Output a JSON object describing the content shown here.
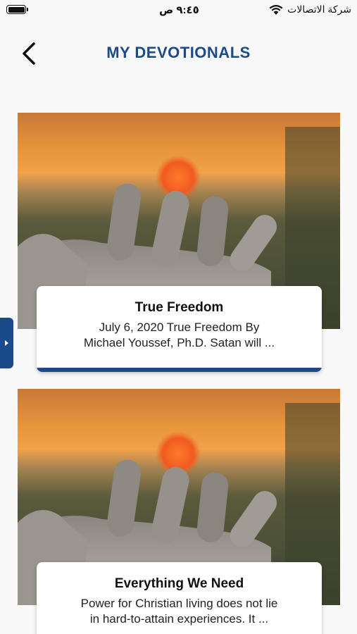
{
  "status_bar": {
    "time": "٩:٤٥ ص",
    "carrier": "شركة الاتصالات"
  },
  "header": {
    "title": "MY DEVOTIONALS",
    "back_icon": "chevron-left-icon"
  },
  "devotionals": [
    {
      "title": "True Freedom",
      "excerpt_line1": "July 6, 2020   True Freedom   By",
      "excerpt_line2": "Michael Youssef, Ph.D. Satan will ...",
      "image": "sunset-hand-image"
    },
    {
      "title": "Everything We Need",
      "excerpt_line1": "Power for Christian living does not lie",
      "excerpt_line2": "in hard-to-attain experiences. It ...",
      "image": "sunset-hand-image"
    }
  ],
  "colors": {
    "accent": "#1b4a8c",
    "background": "#f8f8f8"
  }
}
